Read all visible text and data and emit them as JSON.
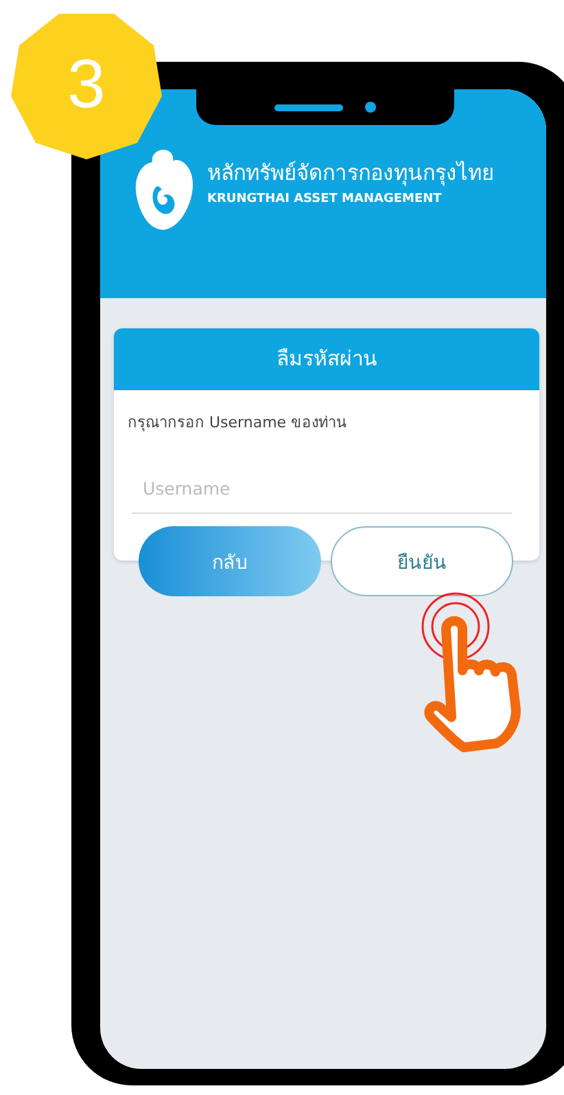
{
  "badge": {
    "text": "3"
  },
  "header": {
    "brand_thai": "หลักทรัพย์จัดการกองทุนกรุงไทย",
    "brand_english": "KRUNGTHAI ASSET MANAGEMENT"
  },
  "card": {
    "title": "ลืมรหัสผ่าน",
    "prompt": "กรุณากรอก Username ของท่าน",
    "field": {
      "placeholder": "Username"
    }
  },
  "buttons": [
    {
      "label": "กลับ",
      "kind": "filled"
    },
    {
      "label": "ยืนยัน",
      "kind": "outline"
    }
  ]
}
